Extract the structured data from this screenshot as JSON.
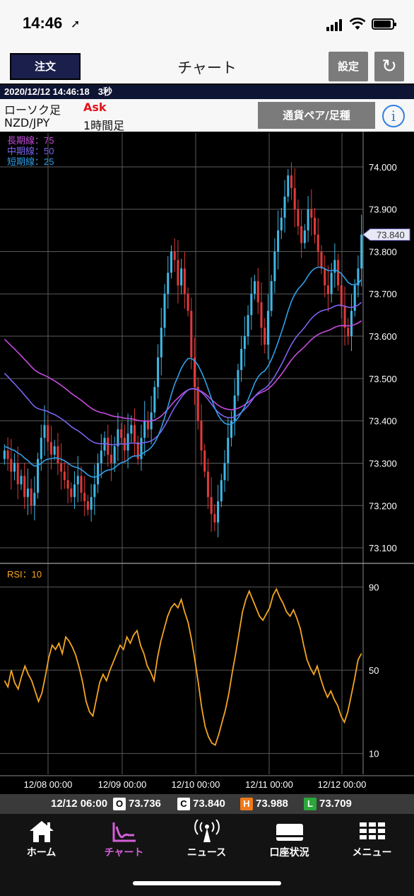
{
  "status": {
    "time": "14:46"
  },
  "nav": {
    "order": "注文",
    "title": "チャート",
    "settings": "設定"
  },
  "info": {
    "datetime": "2020/12/12 14:46:18",
    "interval": "3秒"
  },
  "controls": {
    "chart_type": "ローソク足",
    "price_type": "Ask",
    "pair": "NZD/JPY",
    "timeframe": "1時間足",
    "pair_button": "通貨ペア/足種"
  },
  "legend": {
    "long": "長期線：75",
    "mid": "中期線：50",
    "short": "短期線：25"
  },
  "rsi_label": "RSI：10",
  "ohlc": {
    "time": "12/12 06:00",
    "o_label": "O",
    "o": "73.736",
    "c_label": "C",
    "c": "73.840",
    "h_label": "H",
    "h": "73.988",
    "l_label": "L",
    "l": "73.709"
  },
  "tabs": [
    {
      "label": "ホーム",
      "icon": "home-icon"
    },
    {
      "label": "チャート",
      "icon": "chart-icon"
    },
    {
      "label": "ニュース",
      "icon": "news-icon"
    },
    {
      "label": "口座状況",
      "icon": "account-icon"
    },
    {
      "label": "メニュー",
      "icon": "menu-icon"
    }
  ],
  "colors": {
    "bull": "#3fb8e6",
    "bear": "#e03a3a",
    "sma_long": "#c84be0",
    "sma_mid": "#7b64f0",
    "sma_short": "#2fa0e8",
    "rsi": "#f5a623"
  },
  "chart_data": [
    {
      "type": "candlestick",
      "pair": "NZD/JPY",
      "timeframe": "1時間足",
      "price_tags": [
        "73.840"
      ],
      "y_ticks": [
        "74.000",
        "73.900",
        "73.800",
        "73.700",
        "73.600",
        "73.500",
        "73.400",
        "73.300",
        "73.200",
        "73.100"
      ],
      "y_ticks_values": [
        74.0,
        73.9,
        73.8,
        73.7,
        73.6,
        73.5,
        73.4,
        73.3,
        73.2,
        73.1
      ],
      "ylim": [
        73.07,
        74.08
      ],
      "x_ticks": [
        "12/08 00:00",
        "12/09 00:00",
        "12/10 00:00",
        "12/11 00:00",
        "12/12 00:00"
      ],
      "closes": [
        73.33,
        73.31,
        73.28,
        73.3,
        73.25,
        73.27,
        73.22,
        73.24,
        73.2,
        73.23,
        73.31,
        73.36,
        73.39,
        73.35,
        73.32,
        73.34,
        73.3,
        73.28,
        73.26,
        73.24,
        73.22,
        73.25,
        73.27,
        73.23,
        73.21,
        73.19,
        73.22,
        73.25,
        73.3,
        73.33,
        73.36,
        73.32,
        73.3,
        73.34,
        73.38,
        73.36,
        73.33,
        73.37,
        73.39,
        73.35,
        73.31,
        73.36,
        73.4,
        73.38,
        73.42,
        73.48,
        73.55,
        73.62,
        73.7,
        73.75,
        73.8,
        73.78,
        73.72,
        73.76,
        73.7,
        73.66,
        73.55,
        73.48,
        73.4,
        73.33,
        73.28,
        73.22,
        73.18,
        73.16,
        73.21,
        73.26,
        73.3,
        73.36,
        73.4,
        73.46,
        73.52,
        73.57,
        73.6,
        73.65,
        73.7,
        73.73,
        73.68,
        73.62,
        73.58,
        73.66,
        73.73,
        73.8,
        73.85,
        73.88,
        73.93,
        73.98,
        73.95,
        73.9,
        73.86,
        73.82,
        73.85,
        73.9,
        73.88,
        73.84,
        73.8,
        73.76,
        73.72,
        73.7,
        73.75,
        73.78,
        73.72,
        73.67,
        73.62,
        73.6,
        73.66,
        73.72,
        73.76,
        73.84
      ],
      "sma_short_start": 73.34,
      "sma_mid_start": 73.52,
      "sma_long_start": 73.6
    },
    {
      "type": "line",
      "series": [
        {
          "name": "RSI：10"
        }
      ],
      "y_ticks": [
        "90",
        "50",
        "10"
      ],
      "y_ticks_values": [
        90,
        50,
        10
      ],
      "ylim": [
        0,
        100
      ],
      "values": [
        45,
        42,
        50,
        44,
        41,
        47,
        52,
        48,
        45,
        40,
        35,
        39,
        47,
        56,
        62,
        60,
        63,
        58,
        66,
        64,
        61,
        57,
        51,
        44,
        35,
        30,
        28,
        36,
        44,
        48,
        45,
        50,
        54,
        58,
        62,
        60,
        66,
        63,
        67,
        69,
        62,
        58,
        52,
        49,
        45,
        56,
        64,
        70,
        76,
        80,
        82,
        80,
        84,
        78,
        73,
        65,
        55,
        44,
        32,
        23,
        18,
        15,
        14,
        19,
        25,
        31,
        39,
        49,
        58,
        68,
        78,
        84,
        88,
        84,
        80,
        76,
        74,
        77,
        80,
        86,
        89,
        85,
        82,
        78,
        76,
        79,
        75,
        70,
        62,
        55,
        51,
        48,
        52,
        46,
        41,
        37,
        40,
        36,
        33,
        28,
        25,
        30,
        38,
        46,
        55,
        58
      ]
    }
  ]
}
